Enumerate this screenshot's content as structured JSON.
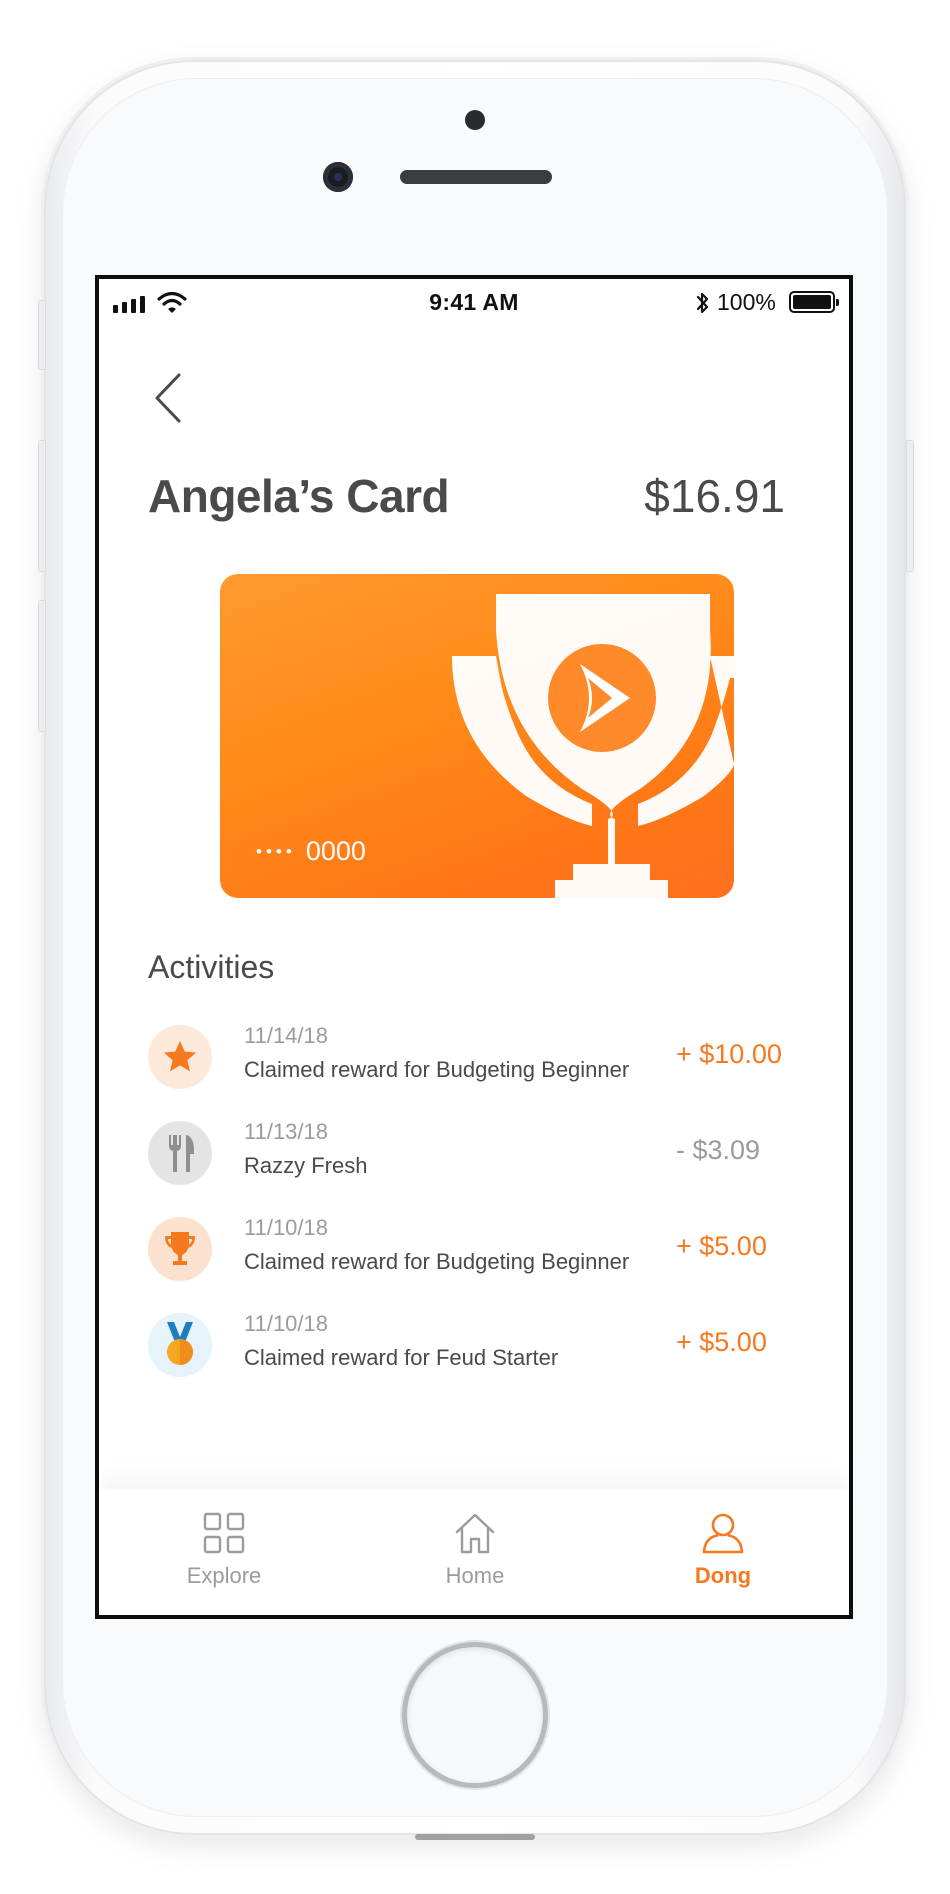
{
  "status_bar": {
    "time": "9:41 AM",
    "battery_percent": "100%",
    "icons": [
      "signal-icon",
      "wifi-icon",
      "bluetooth-icon",
      "battery-icon"
    ]
  },
  "header": {
    "back_icon": "chevron-left-icon",
    "title": "Angela’s Card",
    "balance": "$16.91"
  },
  "card": {
    "masked_dots": "••••",
    "number_suffix": "0000",
    "emblem_icon": "trophy-icon",
    "gradient": [
      "#ff9a2e",
      "#ff6f20"
    ]
  },
  "activities": {
    "title": "Activities",
    "items": [
      {
        "icon": "star-icon",
        "date": "11/14/18",
        "description": "Claimed reward for Budgeting Beginner",
        "amount": "+ $10.00",
        "type": "credit"
      },
      {
        "icon": "fork-knife-icon",
        "date": "11/13/18",
        "description": "Razzy Fresh",
        "amount": "- $3.09",
        "type": "debit"
      },
      {
        "icon": "trophy-icon",
        "date": "11/10/18",
        "description": "Claimed reward for Budgeting Beginner",
        "amount": "+ $5.00",
        "type": "credit"
      },
      {
        "icon": "medal-icon",
        "date": "11/10/18",
        "description": "Claimed reward for Feud Starter",
        "amount": "+ $5.00",
        "type": "credit"
      }
    ]
  },
  "tabbar": {
    "tabs": [
      {
        "label": "Explore",
        "icon": "grid-icon",
        "active": false
      },
      {
        "label": "Home",
        "icon": "home-icon",
        "active": false
      },
      {
        "label": "Dong",
        "icon": "user-icon",
        "active": true
      }
    ]
  },
  "colors": {
    "accent": "#f5791f",
    "text_primary": "#4a4a4a",
    "text_secondary": "#9b9b9b"
  }
}
